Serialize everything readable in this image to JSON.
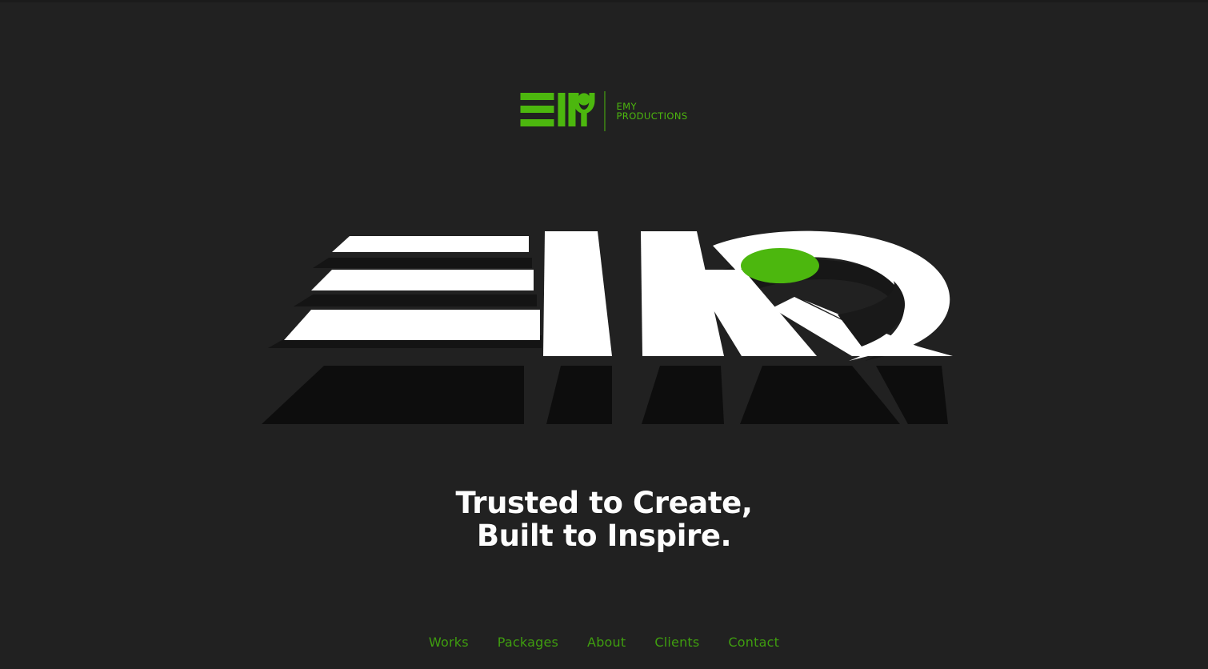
{
  "theme": {
    "background": "#212121",
    "accent_green": "#4cb70e",
    "nav_green": "#3f9e0f",
    "headline_white": "#fdfdfd",
    "shadow_black": "#0d0d0d",
    "art_white": "#ffffff"
  },
  "header": {
    "logo_mark_name": "emy-logo-mark",
    "brand_line_1": "EMY",
    "brand_line_2": "PRODUCTIONS"
  },
  "hero": {
    "artwork_alt": "EMY logo in 3D perspective",
    "headline_line_1": "Trusted to Create,",
    "headline_line_2": "Built to Inspire."
  },
  "nav": {
    "items": [
      {
        "label": "Works"
      },
      {
        "label": "Packages"
      },
      {
        "label": "About"
      },
      {
        "label": "Clients"
      },
      {
        "label": "Contact"
      }
    ]
  }
}
